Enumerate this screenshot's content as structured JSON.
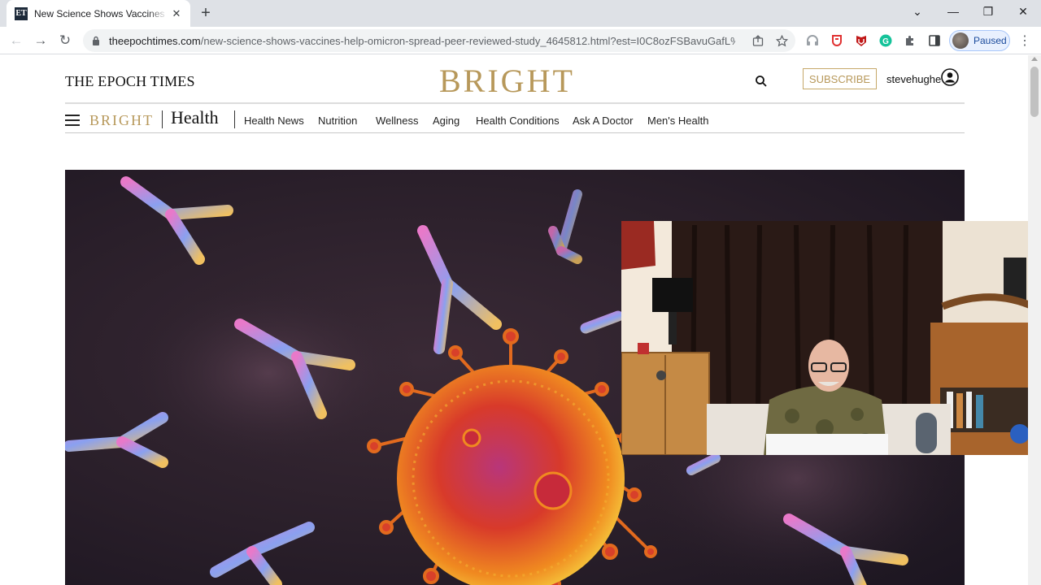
{
  "browser": {
    "tab": {
      "favicon_text": "ET",
      "title": "New Science Shows Vaccines Help Omicron Spread",
      "close_glyph": "✕"
    },
    "new_tab_glyph": "+",
    "window": {
      "dropdown_glyph": "⌄",
      "minimize_glyph": "—",
      "restore_glyph": "❐",
      "close_glyph": "✕"
    },
    "nav": {
      "back_glyph": "←",
      "forward_glyph": "→",
      "reload_glyph": "↻"
    },
    "url": {
      "host": "theepochtimes.com",
      "path": "/new-science-shows-vaccines-help-omicron-spread-peer-reviewed-study_4645812.html?est=I0C8ozFSBavuGafL%..."
    },
    "profile_label": "Paused",
    "menu_glyph": "⋮",
    "extensions": [
      "share-icon",
      "bookmark-star-icon",
      "headphones-extension-icon",
      "shield-extension-icon",
      "mcafee-extension-icon",
      "grammarly-extension-icon",
      "puzzle-extensions-icon",
      "sidepanel-icon"
    ],
    "colors": {
      "tabstrip": "#dee1e6",
      "omnibox": "#f1f3f4",
      "profile_bg": "#e8f0fe"
    }
  },
  "site": {
    "masthead": "THE EPOCH TIMES",
    "brand": "BRIGHT",
    "subscribe_label": "SUBSCRIBE",
    "username": "stevehughe",
    "section_brand": "BRIGHT",
    "section_title": "Health",
    "nav_items": [
      "Health News",
      "Nutrition",
      "Wellness",
      "Aging",
      "Health Conditions",
      "Ask A Doctor",
      "Men's Health"
    ],
    "colors": {
      "gold": "#b7985a",
      "text": "#111111"
    }
  }
}
